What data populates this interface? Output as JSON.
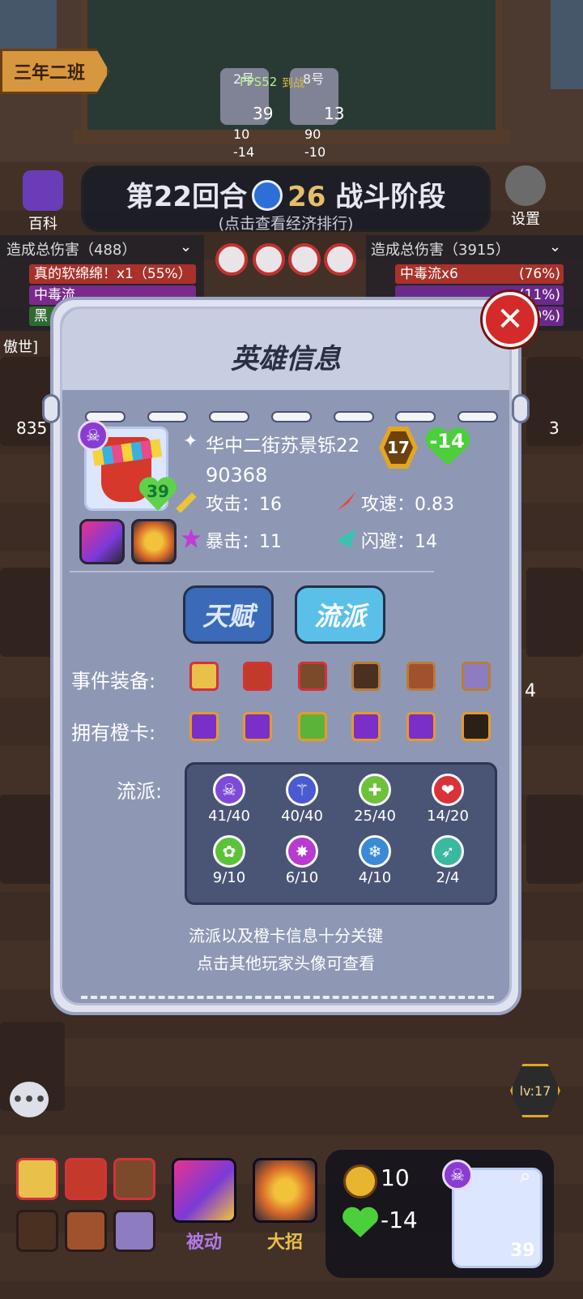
{
  "top": {
    "class_sign": "三年二班",
    "fps": "FPS52",
    "opponents": [
      {
        "num": "2号",
        "badge": "39",
        "coins": "10",
        "hp": "-14"
      },
      {
        "num": "8号",
        "badge": "13",
        "coins": "90",
        "hp": "-10"
      }
    ],
    "battle_tag": "到战"
  },
  "round": {
    "main": "第22回合",
    "timer": "26",
    "phase": "战斗阶段",
    "sub": "(点击查看经济排行)"
  },
  "side_buttons": {
    "encyclopedia": "百科",
    "settings": "设置"
  },
  "damage_left": {
    "title": "造成总伤害（488）",
    "rows": [
      {
        "label": "真的软绵绵！x1（55%）",
        "color": "#c0392b"
      },
      {
        "label": "中毒流",
        "color": "#9b2fae"
      },
      {
        "label": "黑",
        "color": "#2f7d32"
      }
    ],
    "side_label": "傲世]"
  },
  "damage_right": {
    "title": "造成总伤害（3915）",
    "rows": [
      {
        "label": "中毒流x6",
        "pct": "(76%)",
        "color": "#c0392b"
      },
      {
        "label": "",
        "pct": "(11%)",
        "color": "#7a3cb0"
      },
      {
        "label": "",
        "pct": "9%)",
        "color": "#7a3cb0"
      }
    ]
  },
  "side_counts": {
    "left": "835",
    "right": "3",
    "right_heart": "4"
  },
  "modal": {
    "title": "英雄信息",
    "player_name": "华中二街苏景铄22",
    "level": "17",
    "hp": "-14",
    "player_id": "90368",
    "avatar_hp": "39",
    "stats": {
      "attack": "攻击：16",
      "attack_speed": "攻速：0.83",
      "crit": "暴击：11",
      "dodge": "闪避：14"
    },
    "tabs": {
      "talent": "天赋",
      "school": "流派"
    },
    "events_label": "事件装备:",
    "orange_label": "拥有橙卡:",
    "school_label": "流派:",
    "events": [
      {
        "color": "#e8c04a",
        "border": "#d4323a"
      },
      {
        "color": "#c33a2a",
        "border": "#d4323a"
      },
      {
        "color": "#7a4a2a",
        "border": "#d4323a"
      },
      {
        "color": "#4a3020",
        "border": "#b97c3a"
      },
      {
        "color": "#a0522d",
        "border": "#b97c3a"
      },
      {
        "color": "#8d7cc0",
        "border": "#b97c3a"
      }
    ],
    "orange_cards": [
      {
        "color": "#7b2fc9"
      },
      {
        "color": "#7b2fc9"
      },
      {
        "color": "#5cb33a"
      },
      {
        "color": "#7b2fc9"
      },
      {
        "color": "#7b2fc9"
      },
      {
        "color": "#2a2018"
      }
    ],
    "schools": [
      {
        "icon": "💀",
        "value": "41/40",
        "color": "#7d4bd8"
      },
      {
        "icon": "⚚",
        "value": "40/40",
        "color": "#4a5ad0"
      },
      {
        "icon": "✚",
        "value": "25/40",
        "color": "#6cc23a"
      },
      {
        "icon": "❤",
        "value": "14/20",
        "color": "#d8323a"
      },
      {
        "icon": "🐾",
        "value": "9/10",
        "color": "#5cc23a"
      },
      {
        "icon": "✸",
        "value": "6/10",
        "color": "#b83ad0"
      },
      {
        "icon": "❄",
        "value": "4/10",
        "color": "#3a8ad8"
      },
      {
        "icon": "➶",
        "value": "2/4",
        "color": "#3ab8a0"
      }
    ],
    "hint_line1": "流派以及橙卡信息十分关键",
    "hint_line2": "点击其他玩家头像可查看"
  },
  "bottom": {
    "passive_label": "被动",
    "ultimate_label": "大招",
    "coins": "10",
    "hp": "-14",
    "avatar_hp": "39",
    "level_badge": "lv:17",
    "chat_icon": "•••"
  }
}
